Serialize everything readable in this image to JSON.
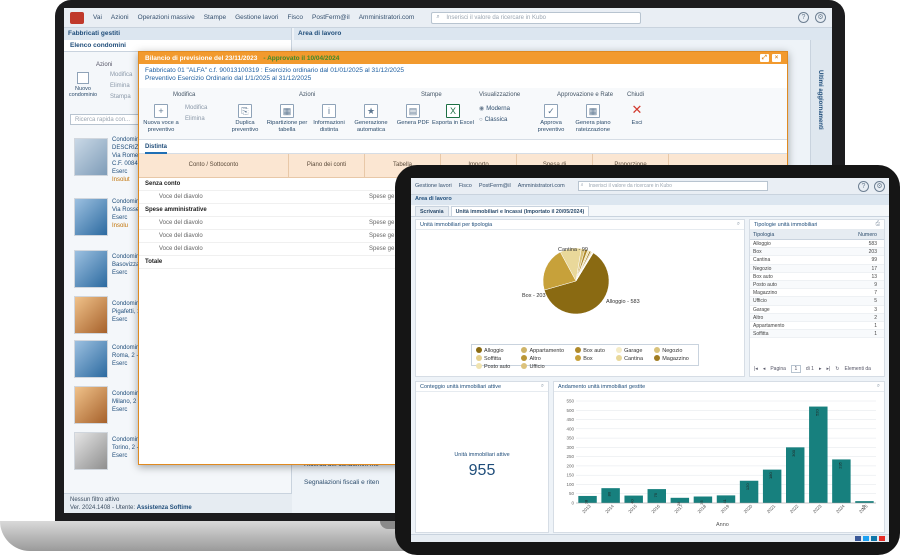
{
  "laptop": {
    "topbar": {
      "menu": [
        "Vai",
        "Azioni",
        "Operazioni massive",
        "Stampe",
        "Gestione lavori",
        "Fisco",
        "PostFerm@il",
        "Amministratori.com"
      ],
      "search_placeholder": "Inserisci il valore da ricercare in Kubo"
    },
    "left_panel": {
      "title": "Fabbricati gestiti",
      "tab": "Elenco condomini",
      "actions_label": "Azioni",
      "new_condo_button": "Nuovo condominio",
      "modify": "Modifica",
      "delete": "Elimina",
      "print": "Stampa",
      "quick_search_placeholder": "Ricerca rapida con...",
      "buildings": [
        {
          "line1": "Condomini",
          "line2": "DESCRIZIO",
          "line3": "Via Romei",
          "line4": "C.F. 0084",
          "line5": "Eserc",
          "line6": "Insolut"
        },
        {
          "line1": "Condomini",
          "line2": "Via Rossell",
          "line3": "Eserc",
          "line4": "Insolu"
        },
        {
          "line1": "Condomini",
          "line2": "Basovizza",
          "line3": "Eserc"
        },
        {
          "line1": "Condomini",
          "line2": "Pigafetti, 1",
          "line3": "Eserc"
        },
        {
          "line1": "Condomini",
          "line2": "Roma, 2 -",
          "line3": "Eserc"
        },
        {
          "line1": "Condomini",
          "line2": "Milano, 2 -",
          "line3": "Eserc"
        },
        {
          "line1": "Condomini",
          "line2": "Torino, 2 -",
          "line3": "Eserc"
        }
      ],
      "filter_status": "Nessun filtro attivo",
      "version": "Ver. 2024.1408 - Utente:",
      "user": "Assistenza Softime"
    },
    "work_area_title": "Area di lavoro",
    "side_strip": "Ultimi aggiornamenti",
    "bottom_links": [
      "Ricerca dei condomini me",
      "Segnalazioni fiscali e riten"
    ],
    "dialog": {
      "title": "Bilancio di previsione del 23/11/2023",
      "status": "- Approvato il 10/04/2024",
      "info_line1": "Fabbricato 01 \"ALFA\" c.f. 90013100319 : Esercizio ordinario dal 01/01/2025 al 31/12/2025",
      "info_line2": "Preventivo Esercizio Ordinario dal 1/1/2025 al 31/12/2025",
      "ribbon": {
        "groups": [
          "Modifica",
          "Azioni",
          "Stampe",
          "Visualizzazione",
          "Approvazione e Rate",
          "Chiudi"
        ],
        "new_item": "Nuova voce a preventivo",
        "modify": "Modifica",
        "delete": "Elimina",
        "duplicate": "Duplica preventivo",
        "split": "Ripartizione per tabella",
        "info": "Informazioni distinta",
        "generate": "Generazione automatica",
        "pdf": "Genera PDF",
        "excel": "Esporta in Excel",
        "view_modern": "Moderna",
        "view_classic": "Classica",
        "approve": "Approva preventivo",
        "plan": "Genera piano rateizzazione",
        "close": "Esci"
      },
      "tab": "Distinta",
      "columns": [
        "Conto / Sottoconto",
        "Piano dei conti",
        "Tabella",
        "Importo",
        "Spesa di",
        "Proporzione"
      ],
      "rows": [
        {
          "label": "Senza conto",
          "bold": true,
          "extra": ""
        },
        {
          "label": "Voce del diavolo",
          "bold": false,
          "extra": "Spese ge"
        },
        {
          "label": "Spese amministrative",
          "bold": true,
          "extra": ""
        },
        {
          "label": "Voce del diavolo",
          "bold": false,
          "extra": "Spese ge"
        },
        {
          "label": "Voce del diavolo",
          "bold": false,
          "extra": "Spese ge"
        },
        {
          "label": "Voce del diavolo",
          "bold": false,
          "extra": "Spese ge"
        },
        {
          "label": "Totale",
          "bold": true,
          "extra": ""
        }
      ]
    }
  },
  "tablet": {
    "topbar": {
      "menu": [
        "Gestione lavori",
        "Fisco",
        "PostFerm@il",
        "Amministratori.com"
      ],
      "search_placeholder": "Inserisci il valore da ricercare in Kubo"
    },
    "work_area_title": "Area di lavoro",
    "tabs": [
      "Scrivania",
      "Unità immobiliari e Incassi (Importato il 20/05/2024)"
    ],
    "pie_card_title": "Unità immobiliari per tipologia",
    "table_card_title": "Tipologie unità immobiliari",
    "table_headers": [
      "Tipologia",
      "Numero"
    ],
    "table_rows": [
      [
        "Alloggio",
        "583"
      ],
      [
        "Box",
        "203"
      ],
      [
        "Cantina",
        "99"
      ],
      [
        "Negozio",
        "17"
      ],
      [
        "Box auto",
        "13"
      ],
      [
        "Posto auto",
        "9"
      ],
      [
        "Magazzino",
        "7"
      ],
      [
        "Ufficio",
        "5"
      ],
      [
        "Garage",
        "3"
      ],
      [
        "Altro",
        "2"
      ],
      [
        "Appartamento",
        "1"
      ],
      [
        "Soffitta",
        "1"
      ]
    ],
    "pager": {
      "page_label": "Pagina",
      "page": "1",
      "of_label": "di 1",
      "elements_label": "Elementi da"
    },
    "count_card_title": "Conteggio unità immobiliari attive",
    "count_label": "Unità immobiliari attive",
    "count_value": "955",
    "bar_card_title": "Andamento unità immobiliari gestite",
    "colors": {
      "accent": "#1f4d7a",
      "bar": "#17807e",
      "pie_dark": "#8a6a12",
      "pie_light": "#f2e6b8"
    }
  },
  "chart_data": [
    {
      "type": "pie",
      "title": "Unità immobiliari per tipologia",
      "categories": [
        "Alloggio",
        "Box",
        "Cantina",
        "Negozio",
        "Box auto",
        "Posto auto",
        "Magazzino",
        "Ufficio",
        "Garage",
        "Altro",
        "Appartamento",
        "Soffitta"
      ],
      "values": [
        583,
        203,
        99,
        17,
        13,
        9,
        7,
        5,
        3,
        2,
        1,
        1
      ],
      "data_labels": [
        "Alloggio - 583",
        "Box - 203",
        "Cantina - 99"
      ],
      "legend": [
        "Alloggio",
        "Appartamento",
        "Box auto",
        "Garage",
        "Negozio",
        "Soffitta",
        "Altro",
        "Box",
        "Cantina",
        "Magazzino",
        "Posto auto",
        "Ufficio"
      ],
      "legend_position": "bottom",
      "colors": [
        "#8a6a12",
        "#c7a13a",
        "#e9d89a",
        "#d9c27a",
        "#b08a2a",
        "#f0e3b0",
        "#a07c22",
        "#dcc27c",
        "#f5ecc8",
        "#ba9636",
        "#cfb468",
        "#e5d08c"
      ]
    },
    {
      "type": "bar",
      "title": "Andamento unità immobiliari gestite",
      "xlabel": "Anno",
      "ylabel": "",
      "categories": [
        "2013",
        "2014",
        "2015",
        "2016",
        "2017",
        "2018",
        "2019",
        "2020",
        "2021",
        "2022",
        "2023",
        "2024",
        "2025"
      ],
      "values": [
        38,
        80,
        40,
        75,
        28,
        35,
        41,
        120,
        180,
        300,
        520,
        235,
        10
      ],
      "ylim": [
        0,
        550
      ],
      "yticks": [
        0,
        50,
        100,
        150,
        200,
        250,
        300,
        350,
        400,
        450,
        500,
        550
      ],
      "grid": true
    }
  ]
}
